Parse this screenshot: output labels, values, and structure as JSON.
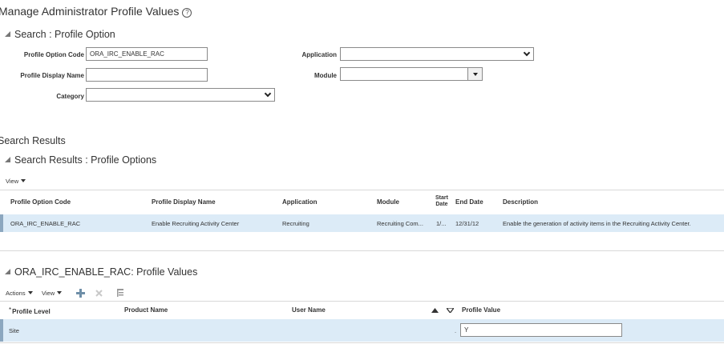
{
  "page": {
    "title": "Manage Administrator Profile Values",
    "help_icon": "?"
  },
  "search": {
    "heading": "Search : Profile Option",
    "profile_option_code_label": "Profile Option Code",
    "profile_option_code_value": "ORA_IRC_ENABLE_RAC",
    "profile_display_name_label": "Profile Display Name",
    "profile_display_name_value": "",
    "category_label": "Category",
    "category_value": "",
    "application_label": "Application",
    "application_value": "",
    "module_label": "Module",
    "module_value": ""
  },
  "results": {
    "title": "Search Results",
    "heading": "Search Results : Profile Options",
    "view_menu": "View",
    "columns": {
      "code": "Profile Option Code",
      "display_name": "Profile Display Name",
      "application": "Application",
      "module": "Module",
      "start_date_1": "Start",
      "start_date_2": "Date",
      "end_date": "End Date",
      "description": "Description"
    },
    "rows": [
      {
        "code": "ORA_IRC_ENABLE_RAC",
        "display_name": "Enable Recruiting Activity Center",
        "application": "Recruiting",
        "module": "Recruiting Com...",
        "start_date": "1/...",
        "end_date": "12/31/12",
        "description": "Enable the generation of activity items in the Recruiting Activity Center."
      }
    ]
  },
  "values": {
    "heading": "ORA_IRC_ENABLE_RAC: Profile Values",
    "actions_menu": "Actions",
    "view_menu": "View",
    "columns": {
      "required_mark": "*",
      "profile_level": "Profile Level",
      "product_name": "Product Name",
      "user_name": "User Name",
      "profile_value": "Profile Value"
    },
    "rows": [
      {
        "profile_level": "Site",
        "product_name": "",
        "user_name": "",
        "dot": ".",
        "profile_value": "Y"
      }
    ]
  },
  "colors": {
    "row_highlight": "#dcebf7",
    "row_selector": "#8ca7bf",
    "border": "#8a8a8a"
  }
}
